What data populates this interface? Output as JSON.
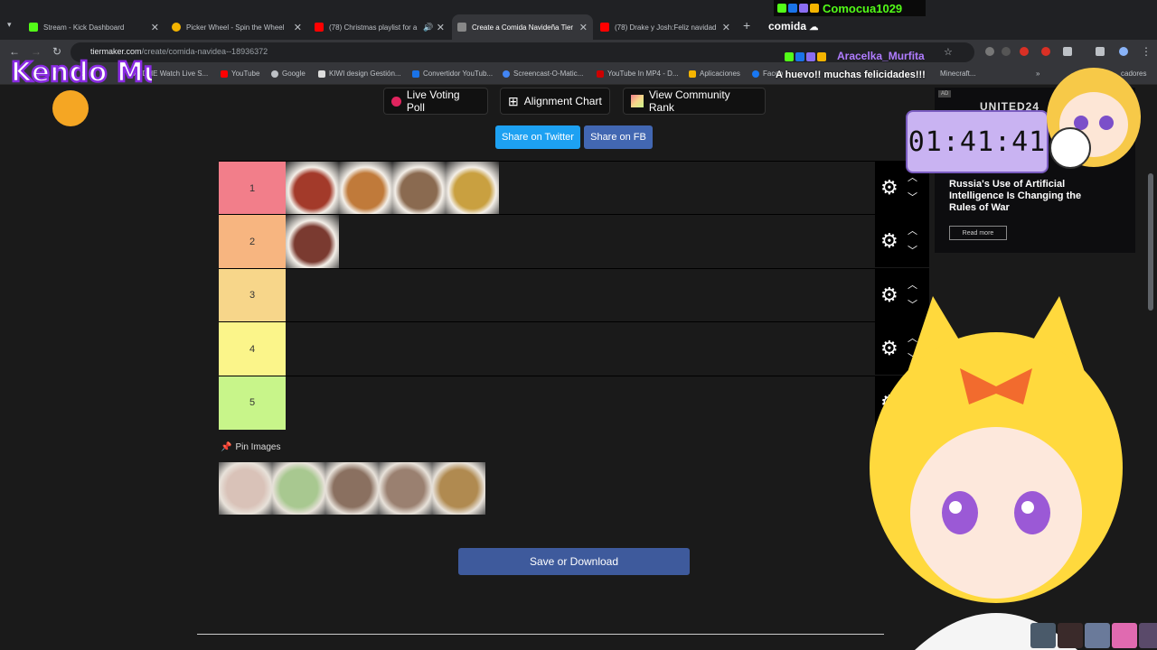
{
  "tabs": [
    {
      "label": "Stream - Kick Dashboard",
      "color": "#53fc18"
    },
    {
      "label": "Picker Wheel - Spin the Wheel",
      "color": "#f4b400"
    },
    {
      "label": "(78) Christmas playlist for a",
      "color": "#ff0000"
    },
    {
      "label": "Create a Comida Navideña Tier",
      "color": "#888888"
    },
    {
      "label": "(78) Drake y Josh:Feliz navidad",
      "color": "#ff0000"
    }
  ],
  "address": {
    "domain": "tiermaker.com",
    "path": "/create/comida-navidea--18936372"
  },
  "bookmarks": [
    "ATDHE Watch Live S...",
    "YouTube",
    "Google",
    "KIWI design Gestión...",
    "Convertidor YouTub...",
    "Screencast-O-Matic...",
    "YouTube In MP4 - D...",
    "Aplicaciones",
    "Faceb",
    "Minecraft...",
    "cadores"
  ],
  "toolbar": {
    "live_voting": "Live Voting Poll",
    "alignment": "Alignment Chart",
    "community": "View Community Rank",
    "share_twitter": "Share on Twitter",
    "share_fb": "Share on FB"
  },
  "tiers": [
    {
      "label": "1",
      "color": "#f27e8a",
      "items": [
        "#a33a2a",
        "#c07a3a",
        "#8a6a50",
        "#c9a040"
      ]
    },
    {
      "label": "2",
      "color": "#f7b580",
      "items": [
        "#7a3a30"
      ]
    },
    {
      "label": "3",
      "color": "#f7d68a",
      "items": []
    },
    {
      "label": "4",
      "color": "#fbf58a",
      "items": []
    },
    {
      "label": "5",
      "color": "#c8f58a",
      "items": []
    }
  ],
  "pin": {
    "title": "Pin Images",
    "items": [
      "#d9c2b8",
      "#a8c890",
      "#8a7060",
      "#9a8070",
      "#b08a50"
    ]
  },
  "save_label": "Save or Download",
  "ad": {
    "badge": "AD",
    "brand": "UNITED24",
    "headline": "Russia's Use of Artificial Intelligence Is Changing the Rules of War",
    "button": "Read more"
  },
  "overlay": {
    "chat_user1": "Comocua1029",
    "chat_msg1": "comida",
    "chat_user2": "Aracelka_Murfita",
    "chat_msg2": "A huevo!! muchas felicidades!!!",
    "timer": "01:41:41",
    "logo_text": "Kendo Murft"
  }
}
